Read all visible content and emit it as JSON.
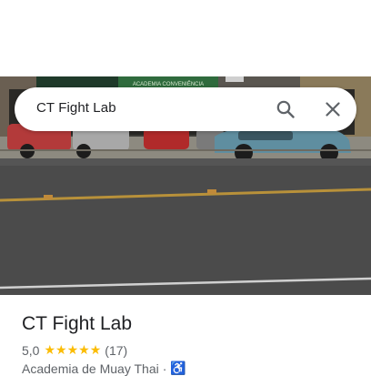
{
  "search": {
    "query": "CT Fight Lab"
  },
  "icons": {
    "search": "search-icon",
    "close": "close-icon",
    "star": "star-icon",
    "accessibility": "wheelchair-icon"
  },
  "photo": {
    "sign_text": "ACADEMIA CONVENIÊNCIA"
  },
  "place": {
    "title": "CT Fight Lab",
    "rating": "5,0",
    "rating_stars": 5,
    "review_count": "(17)",
    "category": "Academia de Muay Thai",
    "separator": "·"
  },
  "colors": {
    "star": "#fbbc04",
    "accessibility": "#1a73e8",
    "text_primary": "#202124",
    "text_secondary": "#5f6368"
  }
}
